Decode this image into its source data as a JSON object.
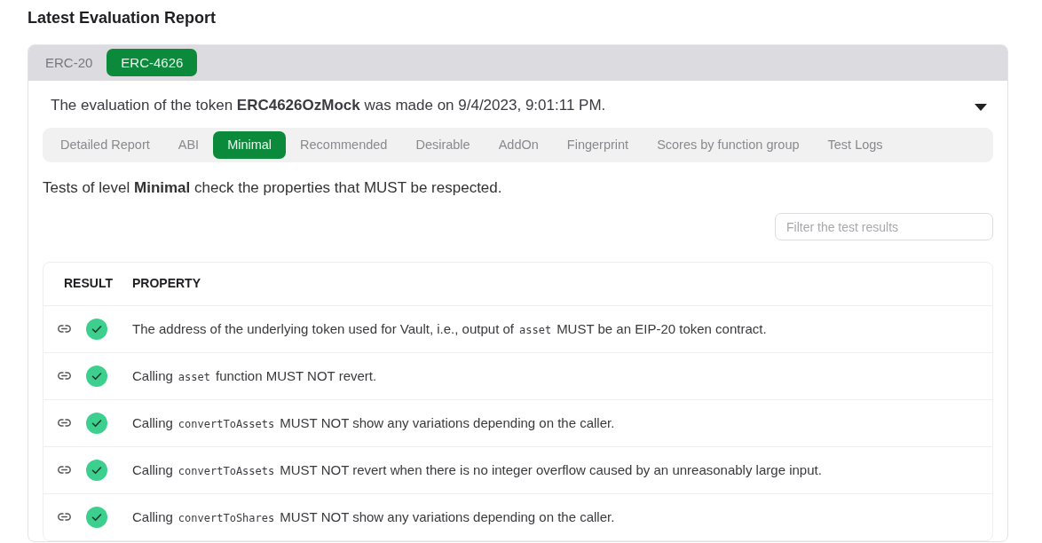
{
  "title": "Latest Evaluation Report",
  "standard_tabs": [
    {
      "label": "ERC-20",
      "selected": false
    },
    {
      "label": "ERC-4626",
      "selected": true
    }
  ],
  "summary": "The evaluation of the token **ERC4626OzMock** was made on 9/4/2023, 9:01:11 PM.",
  "report_tabs": [
    {
      "label": "Detailed Report",
      "selected": false
    },
    {
      "label": "ABI",
      "selected": false
    },
    {
      "label": "Minimal",
      "selected": true
    },
    {
      "label": "Recommended",
      "selected": false
    },
    {
      "label": "Desirable",
      "selected": false
    },
    {
      "label": "AddOn",
      "selected": false
    },
    {
      "label": "Fingerprint",
      "selected": false
    },
    {
      "label": "Scores by function group",
      "selected": false
    },
    {
      "label": "Test Logs",
      "selected": false
    }
  ],
  "level_description": "Tests of level **Minimal** check the properties that MUST be respected.",
  "filter": {
    "placeholder": "Filter the test results"
  },
  "table": {
    "columns": [
      "RESULT",
      "PROPERTY"
    ],
    "rows": [
      {
        "passed": true,
        "property": [
          {
            "kind": "text",
            "text": "The address of the underlying token used for Vault, i.e., output of"
          },
          {
            "kind": "code",
            "text": "asset"
          },
          {
            "kind": "text",
            "text": "MUST be an EIP-20 token contract."
          }
        ]
      },
      {
        "passed": true,
        "property": [
          {
            "kind": "text",
            "text": "Calling"
          },
          {
            "kind": "code",
            "text": "asset"
          },
          {
            "kind": "text",
            "text": "function MUST NOT revert."
          }
        ]
      },
      {
        "passed": true,
        "property": [
          {
            "kind": "text",
            "text": "Calling"
          },
          {
            "kind": "code",
            "text": "convertToAssets"
          },
          {
            "kind": "text",
            "text": "MUST NOT show any variations depending on the caller."
          }
        ]
      },
      {
        "passed": true,
        "property": [
          {
            "kind": "text",
            "text": "Calling"
          },
          {
            "kind": "code",
            "text": "convertToAssets"
          },
          {
            "kind": "text",
            "text": "MUST NOT revert when there is no integer overflow caused by an unreasonably large input."
          }
        ]
      },
      {
        "passed": true,
        "property": [
          {
            "kind": "text",
            "text": "Calling"
          },
          {
            "kind": "code",
            "text": "convertToShares"
          },
          {
            "kind": "text",
            "text": "MUST NOT show any variations depending on the caller."
          }
        ]
      }
    ]
  }
}
